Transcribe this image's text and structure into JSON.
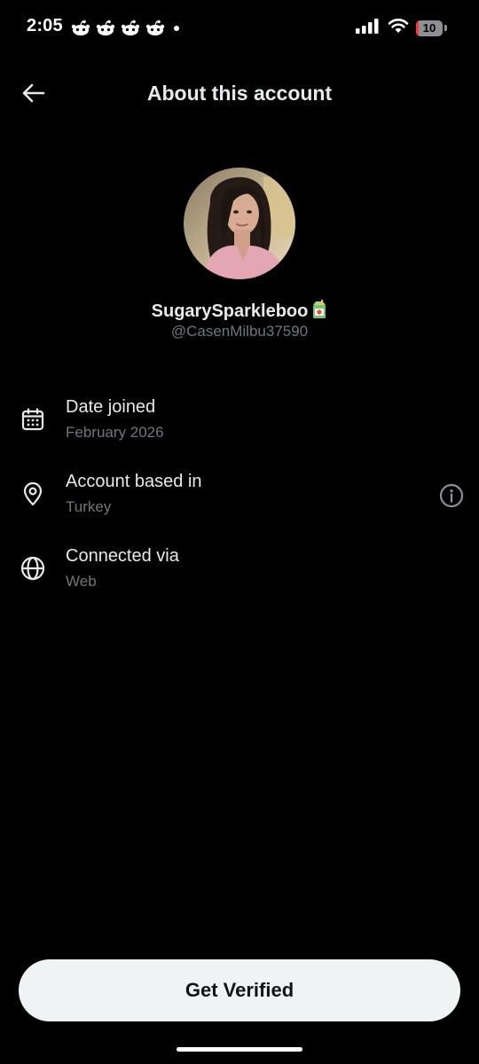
{
  "status_bar": {
    "time": "2:05",
    "notification_icons": [
      "reddit-alien-icon",
      "reddit-alien-icon",
      "reddit-alien-icon",
      "reddit-alien-icon"
    ],
    "battery_level": "10",
    "battery_fraction": 0.1,
    "battery_color": "#ff3b30",
    "icons": [
      "cellular-signal-icon",
      "wifi-icon",
      "battery-icon"
    ]
  },
  "header": {
    "title": "About this account",
    "back_icon": "back-arrow-icon"
  },
  "profile": {
    "display_name": "SugarySparkleboo",
    "display_name_emoji": "juice-box-icon",
    "handle": "@CasenMilbu37590",
    "avatar": "profile-photo"
  },
  "info_rows": [
    {
      "icon": "calendar-icon",
      "label": "Date joined",
      "value": "February 2026"
    },
    {
      "icon": "location-pin-icon",
      "label": "Account based in",
      "value": "Turkey",
      "action_icon": "info-icon"
    },
    {
      "icon": "globe-icon",
      "label": "Connected via",
      "value": "Web"
    }
  ],
  "bottom_button": {
    "label": "Get Verified",
    "background": "#eff3f4"
  },
  "colors": {
    "background": "#000000",
    "primary_text": "#e7e9ea",
    "secondary_text": "#71767b"
  }
}
